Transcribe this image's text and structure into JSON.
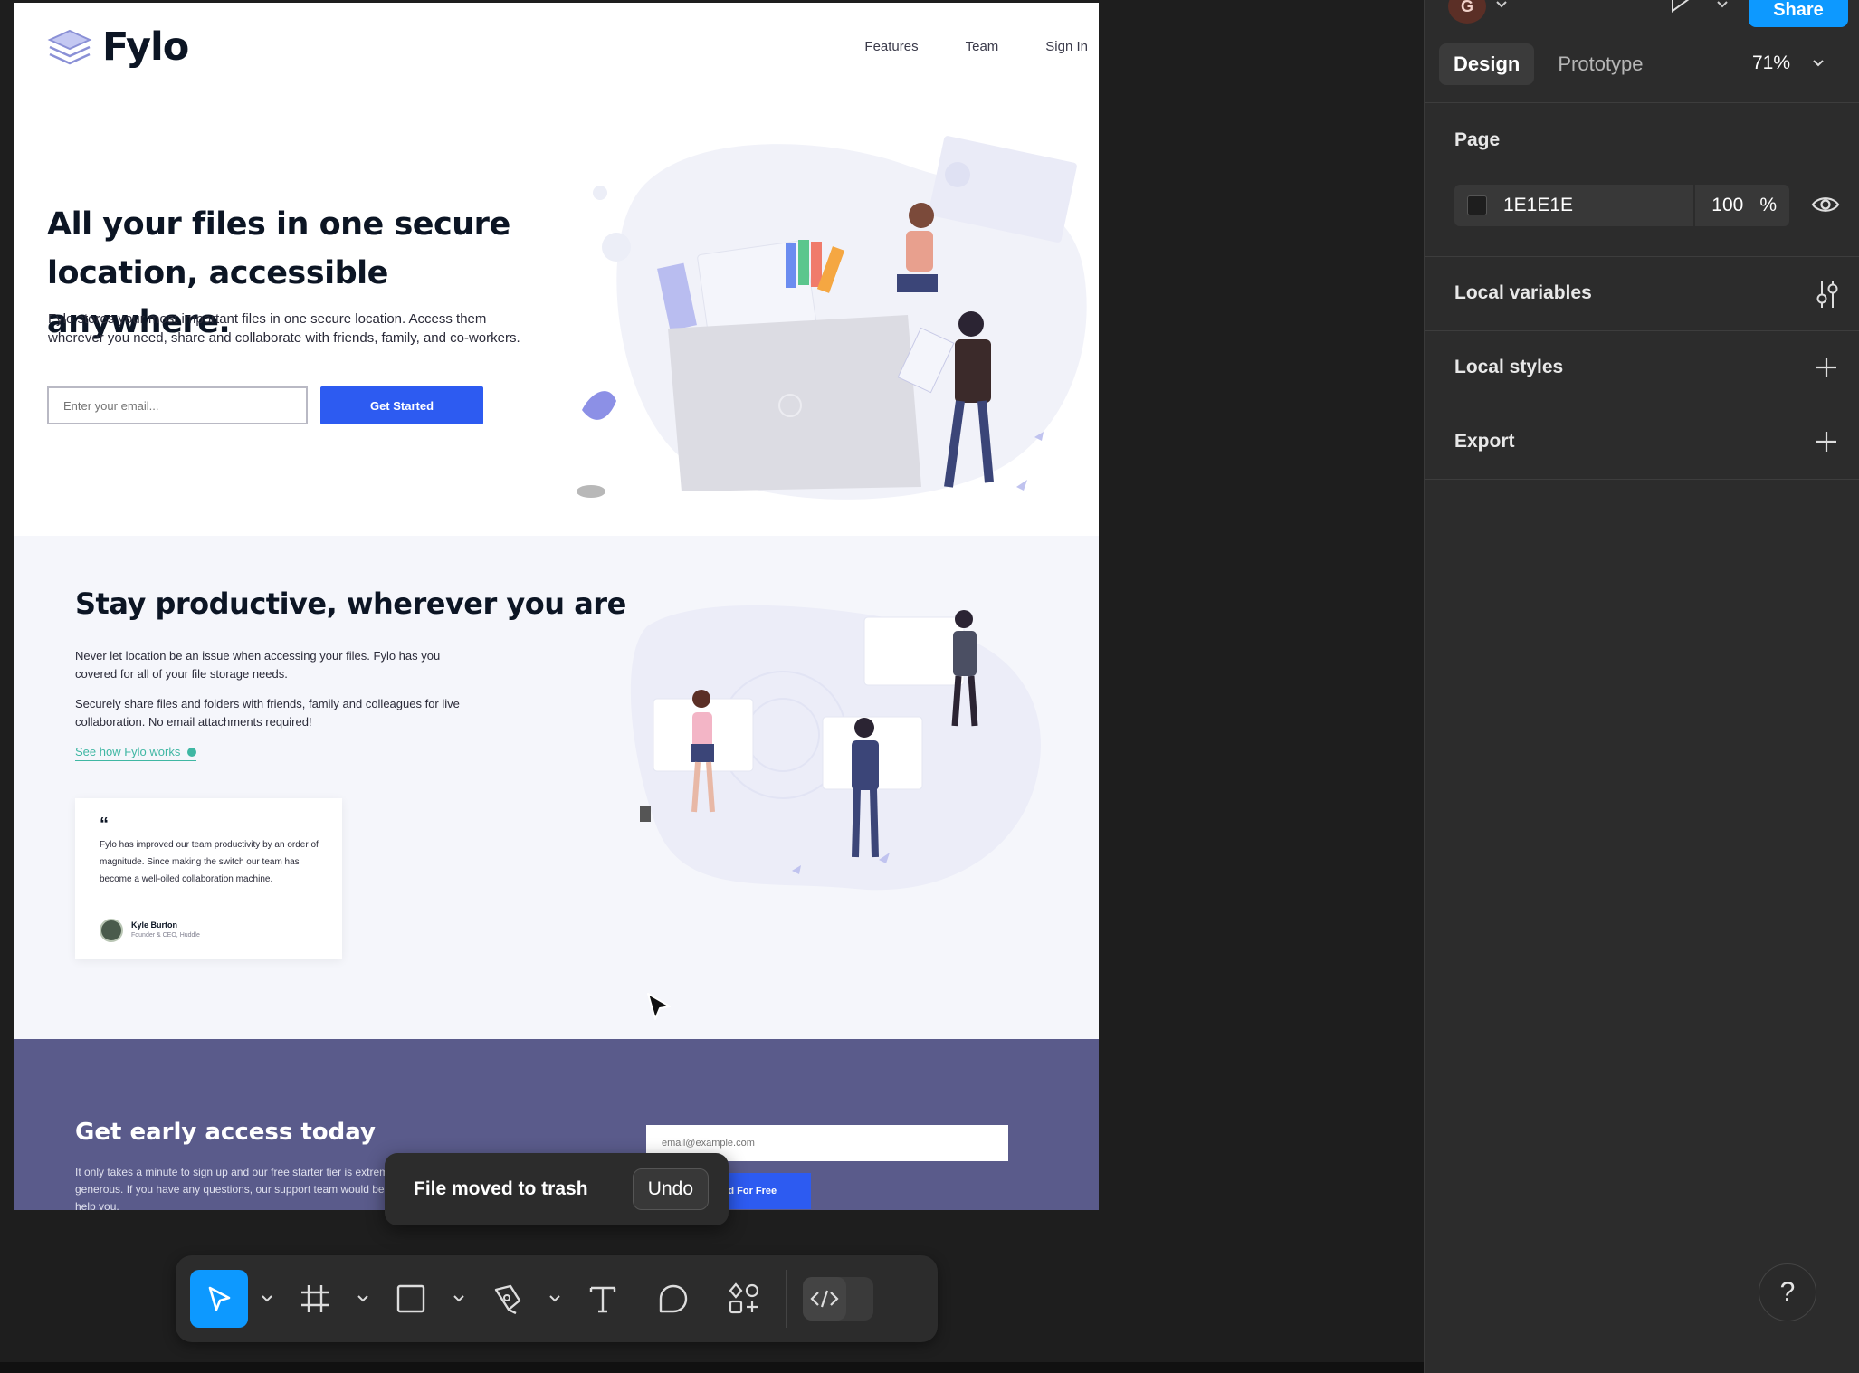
{
  "site": {
    "logo_text": "Fylo",
    "nav": [
      "Features",
      "Team",
      "Sign In"
    ],
    "hero": {
      "title_line1": "All your files in one secure",
      "title_line2": "location, accessible anywhere.",
      "description": "Fylo stores your most important files in one secure location. Access them wherever you need, share and collaborate with friends, family, and co-workers.",
      "email_placeholder": "Enter your email...",
      "cta_label": "Get Started"
    },
    "productive": {
      "title": "Stay productive, wherever you are",
      "para1": "Never let location be an issue when accessing your files. Fylo has you covered for all of your file storage needs.",
      "para2": "Securely share files and folders with friends, family and colleagues for live collaboration. No email attachments required!",
      "link_label": "See how Fylo works",
      "testimonial": {
        "quote_mark": "“",
        "text": "Fylo has improved our team productivity by an order of magnitude. Since making the switch our team has become a well-oiled collaboration machine.",
        "name": "Kyle Burton",
        "role": "Founder & CEO, Huddle"
      }
    },
    "access": {
      "title": "Get early access today",
      "description": "It only takes a minute to sign up and our free starter tier is extremely generous. If you have any questions, our support team would be happy to help you.",
      "email_placeholder": "email@example.com",
      "cta_label": "Get Started For Free"
    }
  },
  "toast": {
    "message": "File moved to trash",
    "undo_label": "Undo"
  },
  "toolbar": {
    "tools": [
      "move-tool",
      "frame-tool",
      "shape-tool",
      "pen-tool",
      "text-tool",
      "comment-tool",
      "actions-tool"
    ],
    "dev_mode_icon": "code-icon"
  },
  "panel": {
    "avatar_letter": "G",
    "share_label": "Share",
    "tabs": [
      "Design",
      "Prototype"
    ],
    "zoom": "71%",
    "page_section": "Page",
    "page_color_hex": "1E1E1E",
    "page_opacity": "100",
    "page_opacity_unit": "%",
    "local_variables": "Local variables",
    "local_styles": "Local styles",
    "export": "Export"
  },
  "help_label": "?",
  "colors": {
    "figma_blue": "#0d99ff",
    "fylo_blue": "#2d5bf1",
    "access_bg": "#5a5b8b",
    "teal": "#3fb7a3",
    "canvas_bg": "#1e1e1e",
    "panel_bg": "#2c2c2c"
  }
}
